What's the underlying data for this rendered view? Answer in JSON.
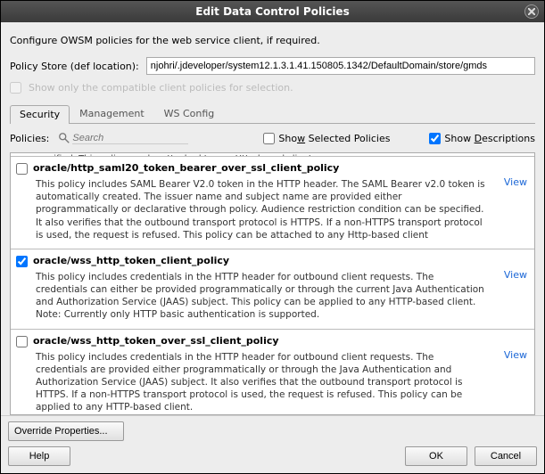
{
  "title": "Edit Data Control Policies",
  "intro": "Configure OWSM policies for the web service client, if required.",
  "policy_store_label": "Policy Store (def location):",
  "policy_store_value": "njohri/.jdeveloper/system12.1.3.1.41.150805.1342/DefaultDomain/store/gmds",
  "compat_label": "Show only the compatible client policies for selection.",
  "tabs": {
    "security": "Security",
    "management": "Management",
    "wsconfig": "WS Config"
  },
  "policies_label": "Policies:",
  "search_placeholder": "Search",
  "show_selected_label": "Show Selected Policies",
  "show_descriptions_label": "Show Descriptions",
  "show_descriptions_checked": true,
  "truncated_top": "specified. This policy can be attached to any Http-based client.",
  "policies": [
    {
      "checked": false,
      "name": "oracle/http_saml20_token_bearer_over_ssl_client_policy",
      "desc": "This policy includes SAML Bearer V2.0 token in the HTTP header. The SAML Bearer v2.0 token is automatically created. The issuer name and subject name are provided either programmatically or declarative through policy. Audience restriction condition can be specified. It also verifies that the outbound transport protocol is HTTPS. If a non-HTTPS transport protocol is used, the request is refused. This policy can be attached to any Http-based client",
      "view": "View"
    },
    {
      "checked": true,
      "name": "oracle/wss_http_token_client_policy",
      "desc": "This policy includes credentials in the HTTP header for outbound client requests. The credentials can either be provided programmatically or through the current Java Authentication and Authorization Service (JAAS) subject. This policy can be applied to any HTTP-based client. Note: Currently only HTTP basic authentication is supported.",
      "view": "View"
    },
    {
      "checked": false,
      "name": "oracle/wss_http_token_over_ssl_client_policy",
      "desc": "This policy includes credentials in the HTTP header for outbound client requests. The credentials are provided either programmatically or through the Java Authentication and Authorization Service (JAAS) subject. It also verifies that the outbound transport protocol is HTTPS. If a non-HTTPS transport protocol is used, the request is refused. This policy can be applied to any HTTP-based client.",
      "view": "View"
    }
  ],
  "override_label": "Override Properties...",
  "help_label": "Help",
  "ok_label": "OK",
  "cancel_label": "Cancel"
}
